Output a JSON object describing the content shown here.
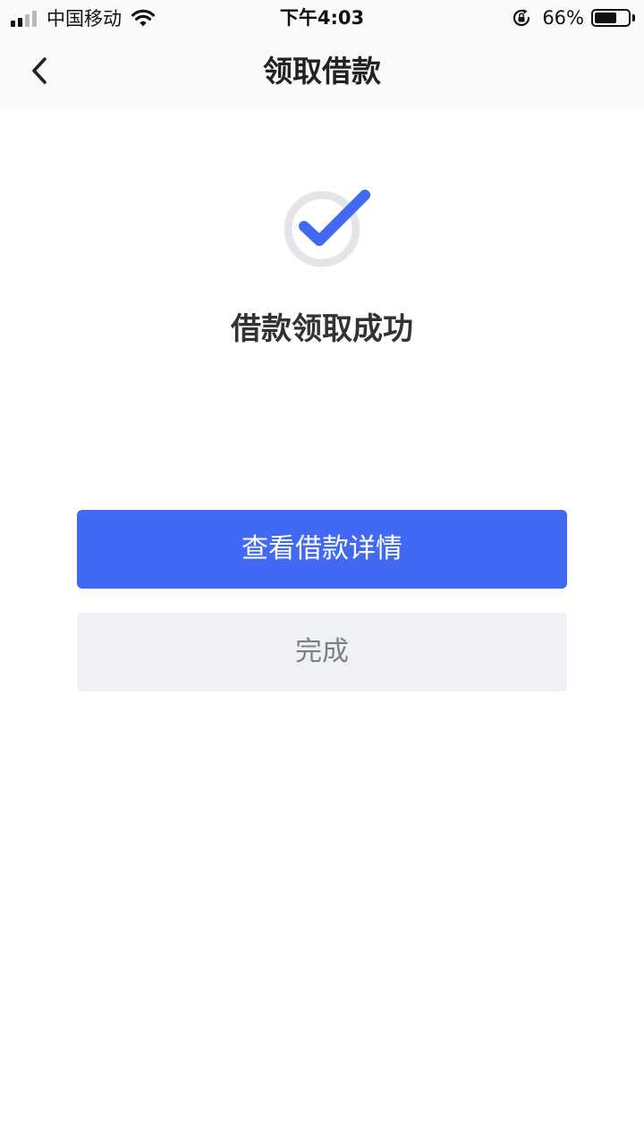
{
  "status_bar": {
    "carrier": "中国移动",
    "time": "下午4:03",
    "battery_percent": "66%",
    "battery_level": 0.66,
    "signal_bars": 4,
    "signal_active": 2
  },
  "nav": {
    "title": "领取借款",
    "back_icon": "chevron-left-icon"
  },
  "result": {
    "icon": "check-circle-icon",
    "message": "借款领取成功"
  },
  "actions": {
    "primary_label": "查看借款详情",
    "secondary_label": "完成"
  },
  "colors": {
    "accent": "#4169f3",
    "secondary_bg": "#f0f1f5",
    "secondary_text": "#7d7f86",
    "ring": "#e4e5e9"
  }
}
